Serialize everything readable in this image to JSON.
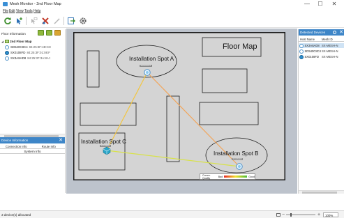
{
  "window": {
    "title": "Mesh Monitor - 2nd Floor Map",
    "minimize": "—",
    "maximize": "☐",
    "close": "✕"
  },
  "menu": [
    "File",
    "Edit",
    "View",
    "Tools",
    "Help"
  ],
  "toolbar": {
    "icons": [
      "refresh-icon",
      "add-device-icon",
      "move-icon",
      "delete-icon",
      "wand-icon",
      "export-icon",
      "settings-icon"
    ]
  },
  "floor_info": {
    "header": "Floor Information",
    "root": "2nd Floor Map",
    "collapse": "◢",
    "devices": [
      {
        "name": "SD540C8C4",
        "mac": "84:25:3F:4D:C8"
      },
      {
        "name": "SX0108FD",
        "mac": "84:25:3F:01:08:F"
      },
      {
        "name": "SX3A8AD8",
        "mac": "84:25:3F:3A:8A:I"
      }
    ]
  },
  "device_info": {
    "header": "Device Information",
    "close": "✕",
    "tabs": [
      "Connection Info",
      "Route Info"
    ],
    "section": "System Info"
  },
  "map": {
    "title": "Floor Map",
    "spots": {
      "a": {
        "label": "Installation Spot A",
        "device": "SD540C8C4"
      },
      "b": {
        "label": "Installation Spot B",
        "device": "SX3A8AD8"
      },
      "c": {
        "label": "Installation Spot C",
        "device": "SX0108FD"
      }
    },
    "legend": {
      "label": "Comm. Quality",
      "bad": "Bad",
      "good": "Good"
    },
    "link_colors": {
      "a_c": "#f3c640",
      "a_b": "#f2a55a",
      "c_b": "#d8e24a"
    }
  },
  "detected": {
    "header": "Detected Devices",
    "close": "✕",
    "columns": [
      "Host Name",
      "Mesh ID"
    ],
    "rows": [
      {
        "host": "SX3A8AD8",
        "mesh": "SX-MESH-N",
        "selected": true
      },
      {
        "host": "SD540C8C4",
        "mesh": "SX-MESH-N",
        "selected": false
      },
      {
        "host": "SX0108FD",
        "mesh": "SX-MESH-N",
        "selected": false
      }
    ]
  },
  "status": {
    "text": "3 device(s) allocated",
    "zoom": "100%",
    "zoom_minus": "−",
    "zoom_plus": "+"
  }
}
